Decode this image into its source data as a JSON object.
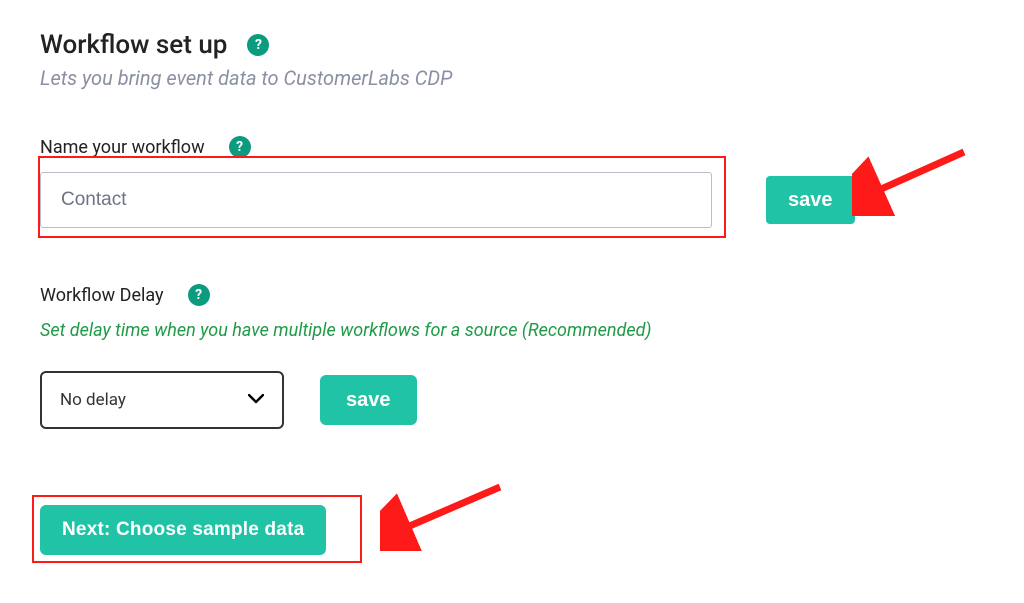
{
  "header": {
    "title": "Workflow set up",
    "subtitle": "Lets you bring event data to CustomerLabs CDP",
    "help_glyph": "?"
  },
  "name_section": {
    "label": "Name your workflow",
    "help_glyph": "?",
    "input_value": "Contact",
    "save_label": "save"
  },
  "delay_section": {
    "label": "Workflow Delay",
    "help_glyph": "?",
    "hint": "Set delay time when you have multiple workflows for a source (Recommended)",
    "select_value": "No delay",
    "save_label": "save"
  },
  "next_button": {
    "label": "Next: Choose sample data"
  },
  "annotations": {
    "arrow_color": "#ff1a1a",
    "highlight_color": "#ff1a1a"
  }
}
